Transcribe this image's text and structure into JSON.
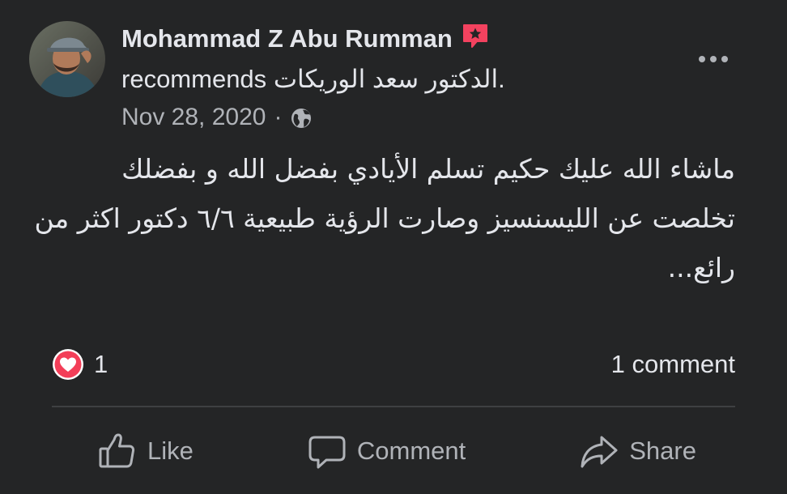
{
  "post": {
    "author_name": "Mohammad Z Abu Rumman",
    "recommend_verb": "recommends",
    "page_name": "الدكتور سعد الوريكات",
    "page_suffix": ".",
    "date": "Nov 28, 2020",
    "separator": "·",
    "privacy_icon": "globe-icon",
    "badge_icon": "recommend-star-icon",
    "body_text": "ماشاء الله عليك حكيم تسلم الأيادي بفضل الله و بفضلك تخلصت عن الليسنسيز وصارت الرؤية طبيعية ٦/٦ دكتور اكثر من رائع..."
  },
  "stats": {
    "reaction_icon": "heart-icon",
    "reaction_count": "1",
    "comment_count": "1 comment"
  },
  "actions": {
    "like_label": "Like",
    "comment_label": "Comment",
    "share_label": "Share"
  },
  "colors": {
    "background": "#242526",
    "primary_text": "#e4e6eb",
    "secondary_text": "#b0b3b8",
    "badge": "#f3425f",
    "heart": "#f33e58"
  }
}
